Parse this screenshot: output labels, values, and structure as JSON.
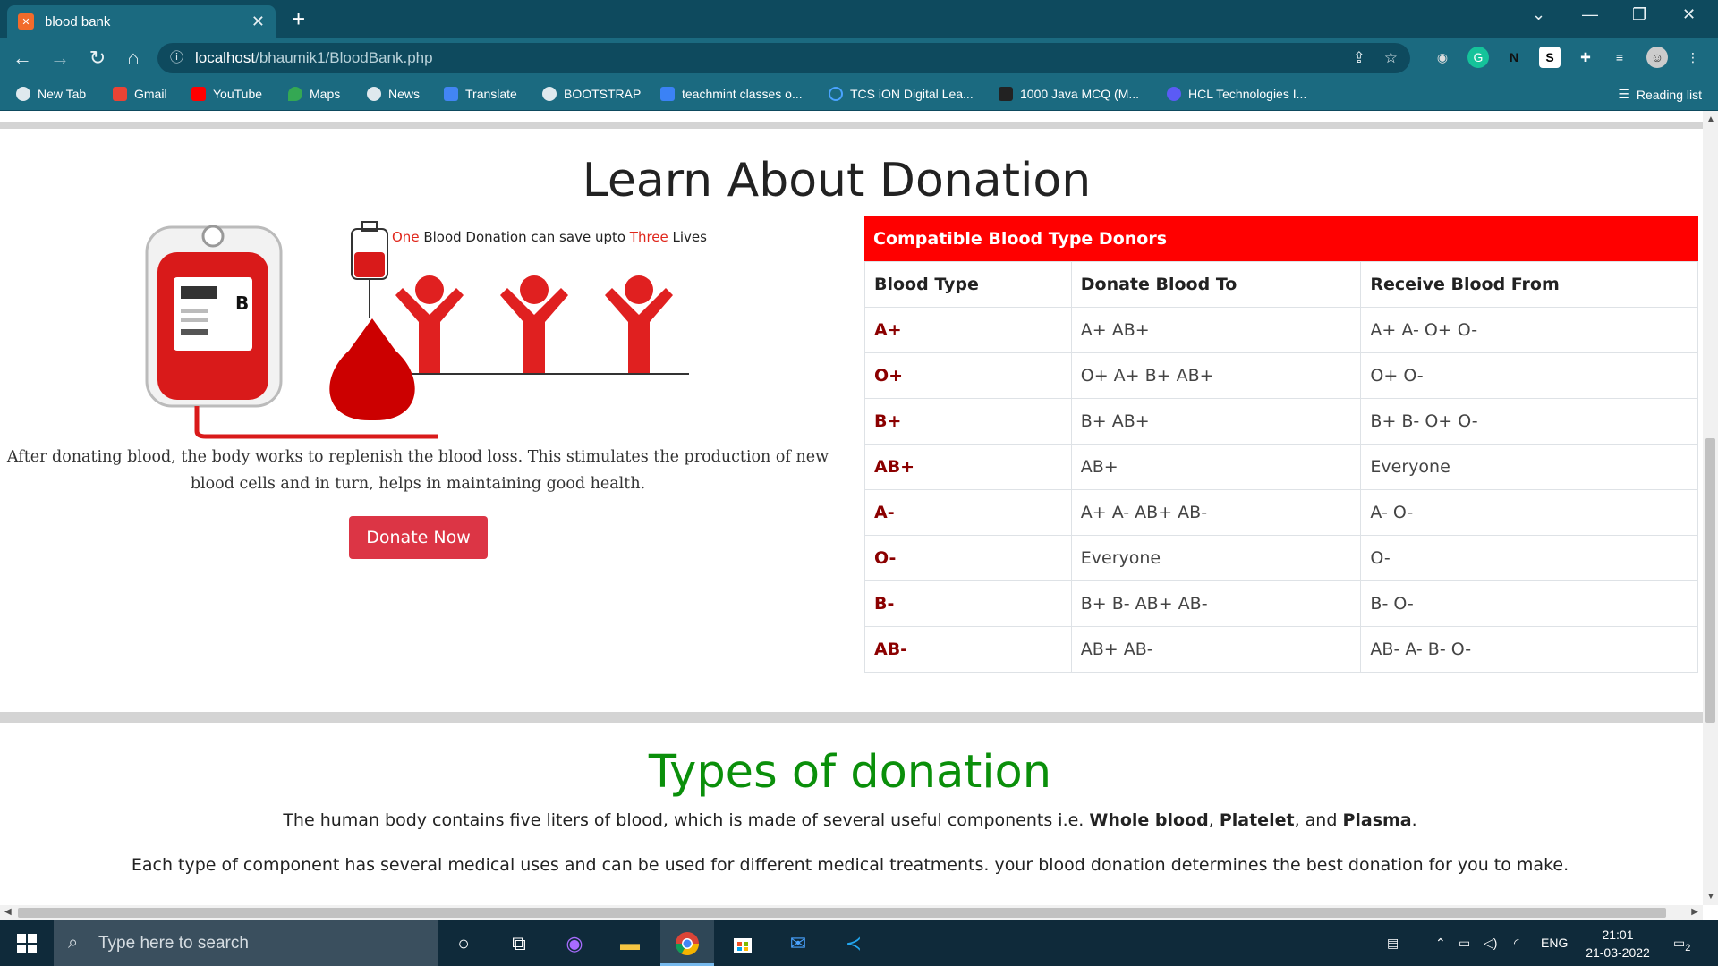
{
  "browser": {
    "tab_title": "blood bank",
    "tab_favicon": "xampp-icon",
    "url_host": "localhost",
    "url_path": "/bhaumik1/BloodBank.php",
    "bookmarks": [
      {
        "label": "New Tab"
      },
      {
        "label": "Gmail"
      },
      {
        "label": "YouTube"
      },
      {
        "label": "Maps"
      },
      {
        "label": "News"
      },
      {
        "label": "Translate"
      },
      {
        "label": "BOOTSTRAP"
      },
      {
        "label": "teachmint classes o..."
      },
      {
        "label": "TCS iON Digital Lea..."
      },
      {
        "label": "1000 Java MCQ (M..."
      },
      {
        "label": "HCL Technologies I..."
      }
    ],
    "reading_list": "Reading list"
  },
  "learn": {
    "title": "Learn About Donation",
    "caption_part1": "One",
    "caption_part2": " Blood Donation can save upto ",
    "caption_part3": "Three",
    "caption_part4": " Lives",
    "bag_label": "B",
    "paragraph": "After donating blood, the body works to replenish the blood loss. This stimulates the production of new blood cells and in turn, helps in maintaining good health.",
    "donate_button": "Donate Now"
  },
  "compat_table": {
    "heading": "Compatible Blood Type Donors",
    "columns": [
      "Blood Type",
      "Donate Blood To",
      "Receive Blood From"
    ],
    "rows": [
      [
        "A+",
        "A+ AB+",
        "A+ A- O+ O-"
      ],
      [
        "O+",
        "O+ A+ B+ AB+",
        "O+ O-"
      ],
      [
        "B+",
        "B+ AB+",
        "B+ B- O+ O-"
      ],
      [
        "AB+",
        "AB+",
        "Everyone"
      ],
      [
        "A-",
        "A+ A- AB+ AB-",
        "A- O-"
      ],
      [
        "O-",
        "Everyone",
        "O-"
      ],
      [
        "B-",
        "B+ B- AB+ AB-",
        "B- O-"
      ],
      [
        "AB-",
        "AB+ AB-",
        "AB- A- B- O-"
      ]
    ]
  },
  "types": {
    "title": "Types of donation",
    "p1_prefix": "The human body contains five liters of blood, which is made of several useful components i.e. ",
    "p1_b1": "Whole blood",
    "p1_sep1": ", ",
    "p1_b2": "Platelet",
    "p1_sep2": ", and ",
    "p1_b3": "Plasma",
    "p1_suffix": ".",
    "p2": "Each type of component has several medical uses and can be used for different medical treatments. your blood donation determines the best donation for you to make."
  },
  "taskbar": {
    "search_placeholder": "Type here to search",
    "language": "ENG",
    "time": "21:01",
    "date": "21-03-2022",
    "notification_count": "2"
  },
  "colors": {
    "brand_red": "#ff0000",
    "button_red": "#dc3545",
    "types_green": "#0a8f0a",
    "chrome_teal": "#1b6a80"
  }
}
